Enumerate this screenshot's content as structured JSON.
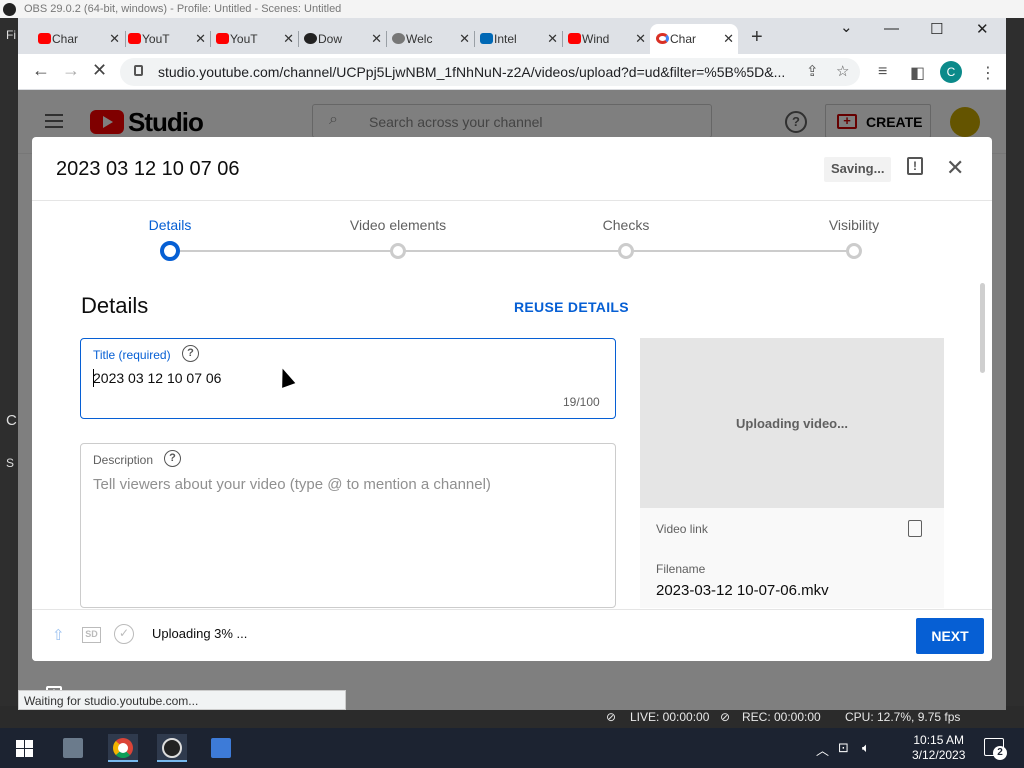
{
  "obs": {
    "title": "OBS 29.0.2 (64-bit, windows) - Profile: Untitled - Scenes: Untitled",
    "left_labels": [
      "Fi",
      "C",
      "S"
    ],
    "status": {
      "live": "LIVE: 00:00:00",
      "rec": "REC: 00:00:00",
      "cpu": "CPU: 12.7%, 9.75 fps"
    }
  },
  "browser": {
    "tabs": [
      {
        "label": "Char",
        "favicon": "youtube-icon",
        "color": "#ff0000"
      },
      {
        "label": "YouT",
        "favicon": "youtube-icon",
        "color": "#ff0000"
      },
      {
        "label": "YouT",
        "favicon": "youtube-icon",
        "color": "#ff0000"
      },
      {
        "label": "Dow",
        "favicon": "obs-icon",
        "color": "#222222"
      },
      {
        "label": "Welc",
        "favicon": "globe-icon",
        "color": "#555555"
      },
      {
        "label": "Intel",
        "favicon": "intel-icon",
        "color": "#0068b5"
      },
      {
        "label": "Wind",
        "favicon": "youtube-icon",
        "color": "#ff0000"
      },
      {
        "label": "Char",
        "favicon": "google-icon",
        "color": "#4285f4"
      }
    ],
    "url": "studio.youtube.com/channel/UCPpj5LjwNBM_1fNhNuN-z2A/videos/upload?d=ud&filter=%5B%5D&...",
    "profile_initial": "C",
    "status_bubble": "Waiting for studio.youtube.com..."
  },
  "studio": {
    "logo_text": "Studio",
    "search_placeholder": "Search across your channel",
    "create_label": "CREATE"
  },
  "dialog": {
    "title": "2023 03 12 10 07 06",
    "saving_label": "Saving...",
    "steps": [
      {
        "label": "Details",
        "active": true
      },
      {
        "label": "Video elements",
        "active": false
      },
      {
        "label": "Checks",
        "active": false
      },
      {
        "label": "Visibility",
        "active": false
      }
    ],
    "section_heading": "Details",
    "reuse_label": "REUSE DETAILS",
    "title_field": {
      "label": "Title (required)",
      "value": "2023 03 12 10 07 06",
      "counter": "19/100"
    },
    "description_field": {
      "label": "Description",
      "placeholder": "Tell viewers about your video (type @ to mention a channel)"
    },
    "preview": {
      "status": "Uploading video...",
      "video_link_label": "Video link",
      "filename_label": "Filename",
      "filename": "2023-03-12 10-07-06.mkv"
    },
    "footer": {
      "hd_badge": "SD",
      "upload_status": "Uploading 3% ...",
      "upload_progress_percent": 3,
      "next_label": "NEXT"
    }
  },
  "taskbar": {
    "time": "10:15 AM",
    "date": "3/12/2023",
    "notification_count": "2"
  }
}
